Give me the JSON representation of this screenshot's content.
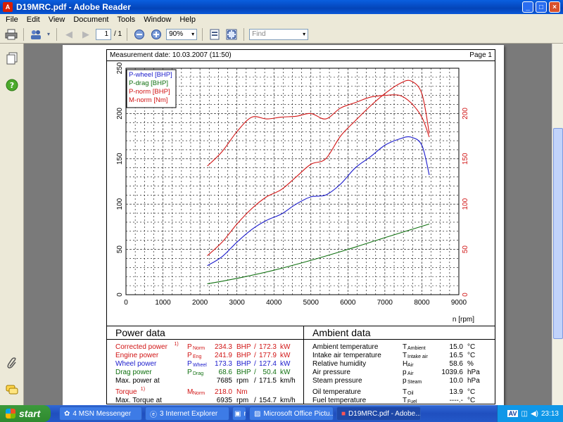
{
  "window": {
    "title": "D19MRC.pdf - Adobe Reader",
    "menu": [
      "File",
      "Edit",
      "View",
      "Document",
      "Tools",
      "Window",
      "Help"
    ],
    "controls": {
      "minimize": "_",
      "maximize": "□",
      "close": "×"
    }
  },
  "toolbar": {
    "page_current": "1",
    "page_total": "/ 1",
    "zoom": "90%",
    "find_placeholder": "Find"
  },
  "document": {
    "measurement_date": "Measurement date: 10.03.2007 (11:50)",
    "page_label": "Page 1",
    "power_data": {
      "title": "Power data",
      "rows": [
        {
          "label": "Corrected power",
          "note": "1)",
          "sym": "P",
          "sub": "Norm",
          "v1": "234.3",
          "u1": "BHP",
          "sep": "/",
          "v2": "172.3",
          "u2": "kW",
          "color": "#d11414"
        },
        {
          "label": "Engine power",
          "note": "",
          "sym": "P",
          "sub": "Eng",
          "v1": "241.9",
          "u1": "BHP",
          "sep": "/",
          "v2": "177.9",
          "u2": "kW",
          "color": "#d11414"
        },
        {
          "label": "Wheel power",
          "note": "",
          "sym": "P",
          "sub": "Wheel",
          "v1": "173.3",
          "u1": "BHP",
          "sep": "/",
          "v2": "127.4",
          "u2": "kW",
          "color": "#1a1acc"
        },
        {
          "label": "Drag power",
          "note": "",
          "sym": "P",
          "sub": "Drag",
          "v1": "68.6",
          "u1": "BHP",
          "sep": "/",
          "v2": "50.4",
          "u2": "kW",
          "color": "#107010"
        },
        {
          "label": "Max. power at",
          "note": "",
          "sym": "",
          "sub": "",
          "v1": "7685",
          "u1": "rpm",
          "sep": "/",
          "v2": "171.5",
          "u2": "km/h",
          "color": "#000000"
        },
        {
          "label": "Torque",
          "note": "1)",
          "sym": "M",
          "sub": "Norm",
          "v1": "218.0",
          "u1": "Nm",
          "sep": "",
          "v2": "",
          "u2": "",
          "color": "#d11414"
        },
        {
          "label": "Max. Torque at",
          "note": "",
          "sym": "",
          "sub": "",
          "v1": "6935",
          "u1": "rpm",
          "sep": "/",
          "v2": "154.7",
          "u2": "km/h",
          "color": "#000000"
        }
      ]
    },
    "ambient_data": {
      "title": "Ambient data",
      "rows": [
        {
          "label": "Ambient temperature",
          "sym": "T",
          "sub": "Ambient",
          "val": "15.0",
          "unit": "°C"
        },
        {
          "label": "Intake air temperature",
          "sym": "T",
          "sub": "Intake air",
          "val": "16.5",
          "unit": "°C"
        },
        {
          "label": "Relative humidity",
          "sym": "H",
          "sub": "Air",
          "val": "58.6",
          "unit": "%"
        },
        {
          "label": "Air pressure",
          "sym": "p",
          "sub": "Air",
          "val": "1039.6",
          "unit": "hPa"
        },
        {
          "label": "Steam pressure",
          "sym": "p",
          "sub": "Steam",
          "val": "10.0",
          "unit": "hPa"
        },
        {
          "label": "Oil temperature",
          "sym": "T",
          "sub": "Oil",
          "val": "13.9",
          "unit": "°C"
        },
        {
          "label": "Fuel temperature",
          "sym": "T",
          "sub": "Fuel",
          "val": "----.-",
          "unit": "°C"
        }
      ]
    }
  },
  "chart_data": {
    "type": "line",
    "xlabel": "n [rpm]",
    "xlim": [
      0,
      9000
    ],
    "ylim": [
      0,
      250
    ],
    "x_ticks": [
      0,
      1000,
      2000,
      3000,
      4000,
      5000,
      6000,
      7000,
      8000,
      9000
    ],
    "y_ticks_left": [
      0,
      50,
      100,
      150,
      200,
      250
    ],
    "y_ticks_right": [
      0,
      50,
      100,
      150,
      200
    ],
    "grid": true,
    "legend_position": "top-left",
    "series": [
      {
        "name": "P-wheel [BHP]",
        "color": "#1a1acc",
        "x": [
          2200,
          2600,
          3000,
          3400,
          3800,
          4200,
          4600,
          5000,
          5400,
          5800,
          6200,
          6600,
          7000,
          7400,
          7700,
          8000,
          8200
        ],
        "y": [
          32,
          42,
          58,
          72,
          82,
          89,
          100,
          108,
          110,
          122,
          140,
          152,
          165,
          172,
          174,
          165,
          132
        ]
      },
      {
        "name": "P-drag [BHP]",
        "color": "#107010",
        "x": [
          2200,
          3000,
          4000,
          5000,
          6000,
          7000,
          8200
        ],
        "y": [
          12,
          18,
          27,
          38,
          50,
          63,
          78
        ]
      },
      {
        "name": "P-norm [BHP]",
        "color": "#d11414",
        "x": [
          2200,
          2600,
          3000,
          3400,
          3800,
          4200,
          4600,
          5000,
          5400,
          5800,
          6200,
          6600,
          7000,
          7400,
          7700,
          8000,
          8200
        ],
        "y": [
          43,
          58,
          78,
          95,
          108,
          116,
          130,
          144,
          150,
          175,
          192,
          208,
          222,
          233,
          236,
          222,
          178
        ]
      },
      {
        "name": "M-norm [Nm]",
        "color": "#d11414",
        "x": [
          2200,
          2600,
          3000,
          3400,
          3800,
          4200,
          4600,
          5000,
          5400,
          5800,
          6200,
          6600,
          7000,
          7400,
          7700,
          8000,
          8200
        ],
        "y": [
          142,
          158,
          180,
          196,
          194,
          196,
          197,
          200,
          194,
          206,
          212,
          218,
          220,
          220,
          212,
          196,
          174
        ]
      }
    ]
  },
  "sidepanel": {
    "icons": [
      "pages-icon",
      "help-icon",
      "attachment-icon",
      "comment-icon"
    ]
  },
  "taskbar": {
    "start": "start",
    "tasks": [
      "4 MSN Messenger",
      "3 Internet Explorer",
      "rpm",
      "Microsoft Office Pictu...",
      "D19MRC.pdf - Adobe..."
    ],
    "tray_lang": "AV",
    "time": "23:13"
  }
}
